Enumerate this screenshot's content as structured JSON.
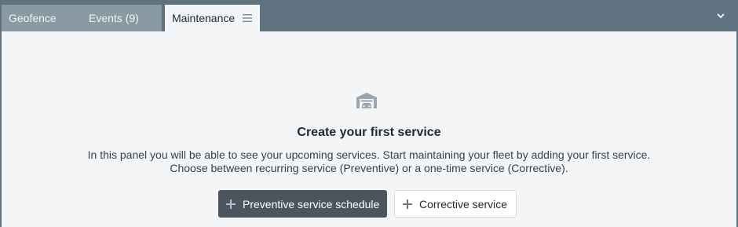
{
  "tabs": [
    {
      "label": "Geofence",
      "active": false
    },
    {
      "label": "Events (9)",
      "active": false
    },
    {
      "label": "Maintenance",
      "active": true
    }
  ],
  "icons": {
    "menu": "menu-icon",
    "collapse": "chevron-down-icon",
    "empty_state": "garage-icon",
    "add": "plus-icon"
  },
  "empty_state": {
    "title": "Create your first service",
    "description_line1": "In this panel you will be able to see your upcoming services. Start maintaining your fleet by adding your first service.",
    "description_line2": "Choose between recurring service (Preventive) or a one-time service (Corrective)."
  },
  "buttons": {
    "preventive_label": "Preventive service schedule",
    "corrective_label": "Corrective service"
  },
  "colors": {
    "header_bg": "#5f7380",
    "primary_button": "#4b5560",
    "panel_bg": "#f4f5f7"
  }
}
